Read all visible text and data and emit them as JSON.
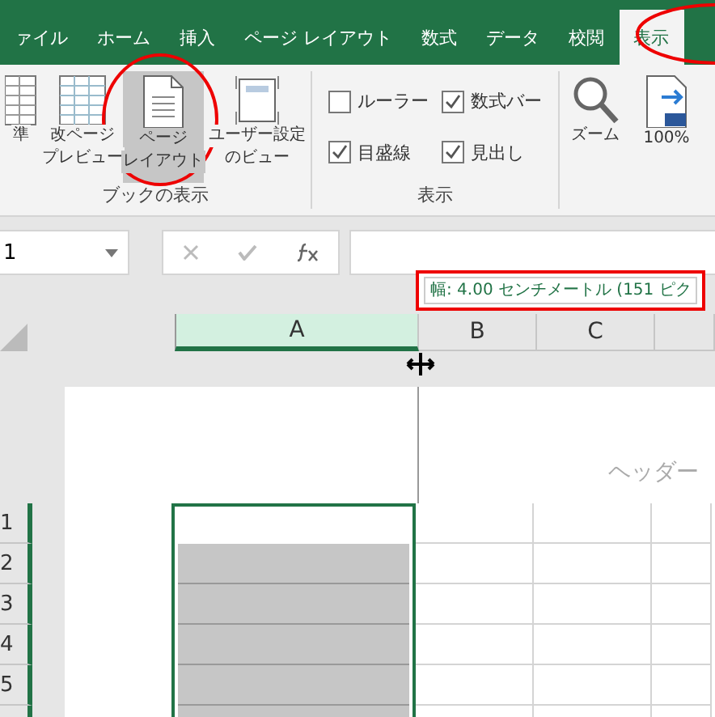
{
  "tabs": [
    {
      "label": "ァイル",
      "selected": false
    },
    {
      "label": "ホーム",
      "selected": false
    },
    {
      "label": "挿入",
      "selected": false
    },
    {
      "label": "ページ レイアウト",
      "selected": false
    },
    {
      "label": "数式",
      "selected": false
    },
    {
      "label": "データ",
      "selected": false
    },
    {
      "label": "校閲",
      "selected": false
    },
    {
      "label": "表示",
      "selected": true
    }
  ],
  "ribbon": {
    "groups": [
      {
        "label": "ブックの表示",
        "kind": "buttons",
        "items": [
          {
            "lines": [
              "準"
            ],
            "selected": false
          },
          {
            "lines": [
              "改ページ",
              "プレビュー"
            ],
            "selected": false
          },
          {
            "lines": [
              "ページ",
              "レイアウト"
            ],
            "selected": true
          },
          {
            "lines": [
              "ユーザー設定",
              "のビュー"
            ],
            "selected": false
          }
        ]
      },
      {
        "label": "表示",
        "kind": "checkboxes",
        "items": [
          {
            "label": "ルーラー",
            "checked": false
          },
          {
            "label": "数式バー",
            "checked": true
          },
          {
            "label": "目盛線",
            "checked": true
          },
          {
            "label": "見出し",
            "checked": true
          }
        ]
      },
      {
        "kind": "buttons",
        "items": [
          {
            "lines": [
              "ズーム"
            ],
            "selected": false
          },
          {
            "lines": [
              "100%"
            ],
            "selected": false
          }
        ]
      }
    ]
  },
  "formula_bar": {
    "name_box": "1"
  },
  "tooltip": "幅: 4.00 センチメートル (151 ピク",
  "sheet": {
    "columns": [
      {
        "label": "A",
        "selected": true
      },
      {
        "label": "B",
        "selected": false
      },
      {
        "label": "C",
        "selected": false
      },
      {
        "selected": false
      }
    ],
    "header_text": "ヘッダー",
    "rows": [
      {
        "label": "1",
        "selected": true,
        "in_selection": false
      },
      {
        "label": "2",
        "selected": true,
        "in_selection": true
      },
      {
        "label": "3",
        "selected": true,
        "in_selection": true
      },
      {
        "label": "4",
        "selected": true,
        "in_selection": true
      },
      {
        "label": "5",
        "selected": true,
        "in_selection": true
      },
      {
        "selected": true,
        "in_selection": true
      }
    ]
  }
}
